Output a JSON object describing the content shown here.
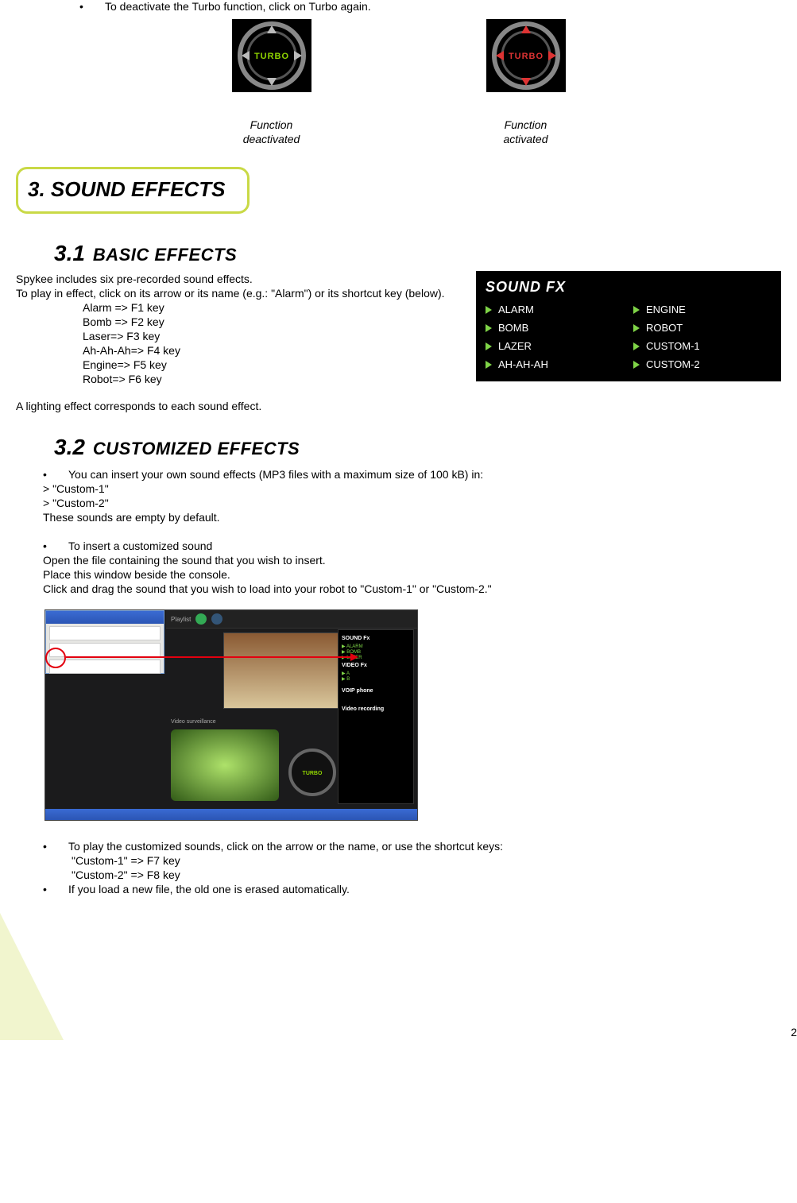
{
  "top_bullet": "To deactivate the Turbo function, click on Turbo again.",
  "turbo": {
    "label": "TURBO",
    "caption_off_a": "Function",
    "caption_off_b": "deactivated",
    "caption_on_a": "Function",
    "caption_on_b": "activated"
  },
  "section3": {
    "title": "3. SOUND EFFECTS"
  },
  "sec31": {
    "num": "3.1",
    "title": "BASIC  EFFECTS",
    "line1": "Spykee includes six pre-recorded sound effects.",
    "line2": "To play in effect, click on its arrow or its name (e.g.: \"Alarm\") or its shortcut key (below).",
    "keys": [
      "Alarm => F1 key",
      "Bomb => F2 key",
      "Laser=> F3 key",
      "Ah-Ah-Ah=> F4 key",
      "Engine=> F5 key",
      "Robot=> F6 key"
    ],
    "line3": "A lighting effect corresponds to each sound effect."
  },
  "sfx_panel": {
    "title": "SOUND FX",
    "items": [
      "ALARM",
      "ENGINE",
      "BOMB",
      "ROBOT",
      "LAZER",
      "CUSTOM-1",
      "AH-AH-AH",
      "CUSTOM-2"
    ]
  },
  "sec32": {
    "num": "3.2",
    "title": "CUSTOMIZED EFFECTS",
    "b1": "You can insert your own sound effects (MP3 files with a maximum size of 100 kB) in:",
    "c1": "> \"Custom-1\"",
    "c2": "> \"Custom-2\"",
    "c3": "These sounds are empty by default.",
    "b2": "To insert a customized sound",
    "d1": "Open the file containing the sound that you wish to insert.",
    "d2": "Place this window beside the console.",
    "d3": "Click and drag the sound that you wish to load into your robot to \"Custom-1\" or \"Custom-2.\"",
    "b3": "To play the customized sounds, click on the arrow or the name, or use the shortcut keys:",
    "e1": "\"Custom-1\"  => F7 key",
    "e2": "\"Custom-2\"  => F8 key",
    "b4": "If you load a new file, the old one is erased automatically."
  },
  "console_panel": {
    "sound_hd": "SOUND Fx",
    "video_hd": "VIDEO Fx",
    "voip": "VOIP phone",
    "rec": "Video recording",
    "surv": "Video surveillance"
  },
  "page_number": "2"
}
